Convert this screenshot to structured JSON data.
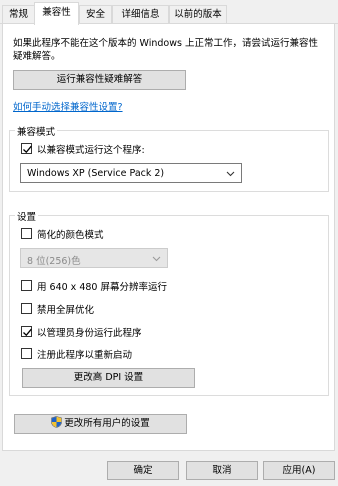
{
  "tabs": [
    "常规",
    "兼容性",
    "安全",
    "详细信息",
    "以前的版本"
  ],
  "active_tab": "兼容性",
  "intro_text": "如果此程序不能在这个版本的 Windows 上正常工作，请尝试运行兼容性疑难解答。",
  "troubleshooter_button": "运行兼容性疑难解答",
  "manual_link": "如何手动选择兼容性设置?",
  "compat_mode": {
    "legend": "兼容模式",
    "checkbox_label": "以兼容模式运行这个程序:",
    "checked": true,
    "selected_os": "Windows XP (Service Pack 2)"
  },
  "settings": {
    "legend": "设置",
    "reduced_color_label": "简化的颜色模式",
    "reduced_color_checked": false,
    "color_select_value": "8 位(256)色",
    "run_640_label": "用 640 x 480 屏幕分辨率运行",
    "run_640_checked": false,
    "disable_fullscreen_label": "禁用全屏优化",
    "disable_fullscreen_checked": false,
    "run_as_admin_label": "以管理员身份运行此程序",
    "run_as_admin_checked": true,
    "register_restart_label": "注册此程序以重新启动",
    "register_restart_checked": false,
    "dpi_button": "更改高 DPI 设置"
  },
  "all_users_button": "更改所有用户的设置",
  "footer": {
    "ok": "确定",
    "cancel": "取消",
    "apply": "应用(A)"
  },
  "colors": {
    "link": "#0066cc",
    "check": "#000000"
  }
}
